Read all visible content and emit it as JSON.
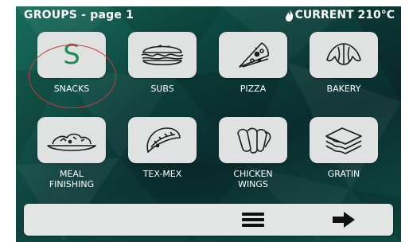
{
  "header": {
    "title": "GROUPS - page 1",
    "current": "CURRENT 210°C"
  },
  "groups": [
    {
      "label": "SNACKS",
      "icon": "letter-s",
      "symbol": "S",
      "highlighted": true
    },
    {
      "label": "SUBS",
      "icon": "sandwich-icon"
    },
    {
      "label": "PIZZA",
      "icon": "pizza-slice-icon"
    },
    {
      "label": "BAKERY",
      "icon": "croissant-icon"
    },
    {
      "label": "MEAL\nFINISHING",
      "icon": "meal-plate-icon"
    },
    {
      "label": "TEX-MEX",
      "icon": "taco-icon"
    },
    {
      "label": "CHICKEN\nWINGS",
      "icon": "chicken-wings-icon"
    },
    {
      "label": "GRATIN",
      "icon": "lasagna-icon"
    }
  ],
  "colors": {
    "accent_green": "#1f8b55",
    "highlight_circle": "#c93a3a",
    "button_bg": "#dfe2e1"
  },
  "bottombar": {
    "icons": [
      "menu-icon",
      "arrow-right-icon"
    ]
  }
}
